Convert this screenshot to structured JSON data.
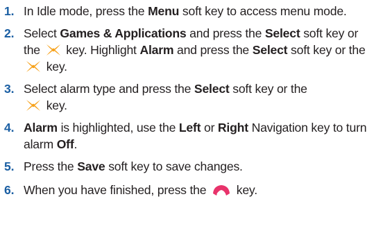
{
  "steps": [
    {
      "number": "1.",
      "t1": "In Idle mode, press the ",
      "b1": "Menu",
      "t2": " soft key to access menu mode."
    },
    {
      "number": "2.",
      "t1": "Select ",
      "b1": "Games & Applications",
      "t2": " and press the ",
      "b2": "Select",
      "t3": " soft key or the ",
      "t4": " key. Highlight ",
      "b3": "Alarm",
      "t5": " and press the ",
      "b4": "Select",
      "t6": " soft key or the ",
      "t7": " key."
    },
    {
      "number": "3.",
      "t1": "Select alarm type and press the ",
      "b1": "Select",
      "t2": " soft key or the ",
      "t3": " key."
    },
    {
      "number": "4.",
      "b1": "Alarm",
      "t1": " is highlighted, use the ",
      "b2": "Left",
      "t2": " or ",
      "b3": "Right",
      "t3": " Navigation key to turn alarm ",
      "b4": "Off",
      "t4": "."
    },
    {
      "number": "5.",
      "t1": "Press the ",
      "b1": "Save",
      "t2": " soft key to save changes."
    },
    {
      "number": "6.",
      "t1": "When you have finished, press the ",
      "t2": " key."
    }
  ],
  "icons": {
    "ok_key": "ok-key-icon",
    "end_key": "end-key-icon"
  },
  "colors": {
    "step_number": "#1b5fa3",
    "ok_key": "#f7a21b",
    "end_key": "#e8336b"
  }
}
